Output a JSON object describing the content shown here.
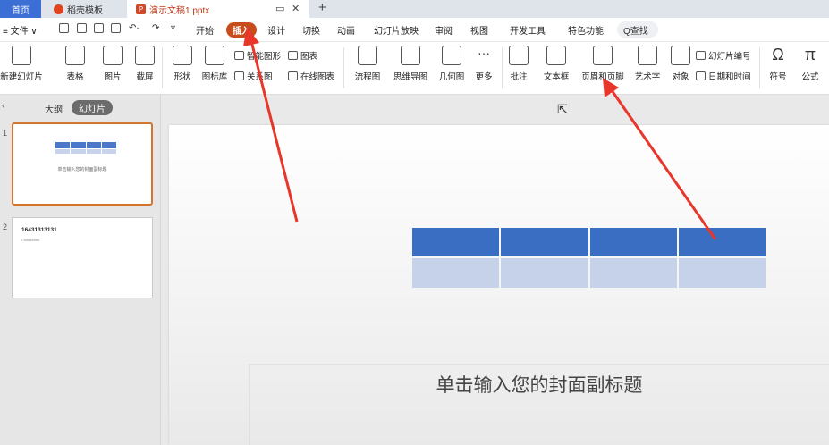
{
  "tabs": {
    "home": "首页",
    "templates": "稻壳模板",
    "doc": "演示文稿1.pptx",
    "add": "+"
  },
  "menu": {
    "file": "≡ 文件 ∨",
    "items": [
      "开始",
      "插入",
      "设计",
      "切换",
      "动画",
      "幻灯片放映",
      "审阅",
      "视图",
      "开发工具",
      "特色功能"
    ],
    "active": "插入",
    "search": "Q查找"
  },
  "ribbon": {
    "new_slide": "新建幻灯片",
    "table": "表格",
    "picture": "图片",
    "screenshot": "截屏",
    "shape": "形状",
    "icon_lib": "图标库",
    "smart_art": "智能图形",
    "chart": "图表",
    "relation": "关系图",
    "online_chart": "在线图表",
    "flowchart": "流程图",
    "mindmap": "思维导图",
    "geometry": "几何图",
    "more": "更多",
    "comment": "批注",
    "textbox": "文本框",
    "header_footer": "页眉和页脚",
    "wordart": "艺术字",
    "object": "对象",
    "slide_number": "幻灯片编号",
    "date_time": "日期和时间",
    "symbol": "符号",
    "formula": "公式"
  },
  "left_panel": {
    "outline": "大纲",
    "slides": "幻灯片",
    "slide1_number": "1",
    "slide1_sub": "单击输入您的封面副标题",
    "slide2_number": "2",
    "slide2_title": "16431313131",
    "slide2_line": "• ########"
  },
  "slide": {
    "subtitle": "单击输入您的封面副标题"
  },
  "colors": {
    "accent": "#c84d1c",
    "table_header": "#3a6ec2",
    "table_body": "#c5d2ea",
    "arrow": "#e8362a"
  }
}
